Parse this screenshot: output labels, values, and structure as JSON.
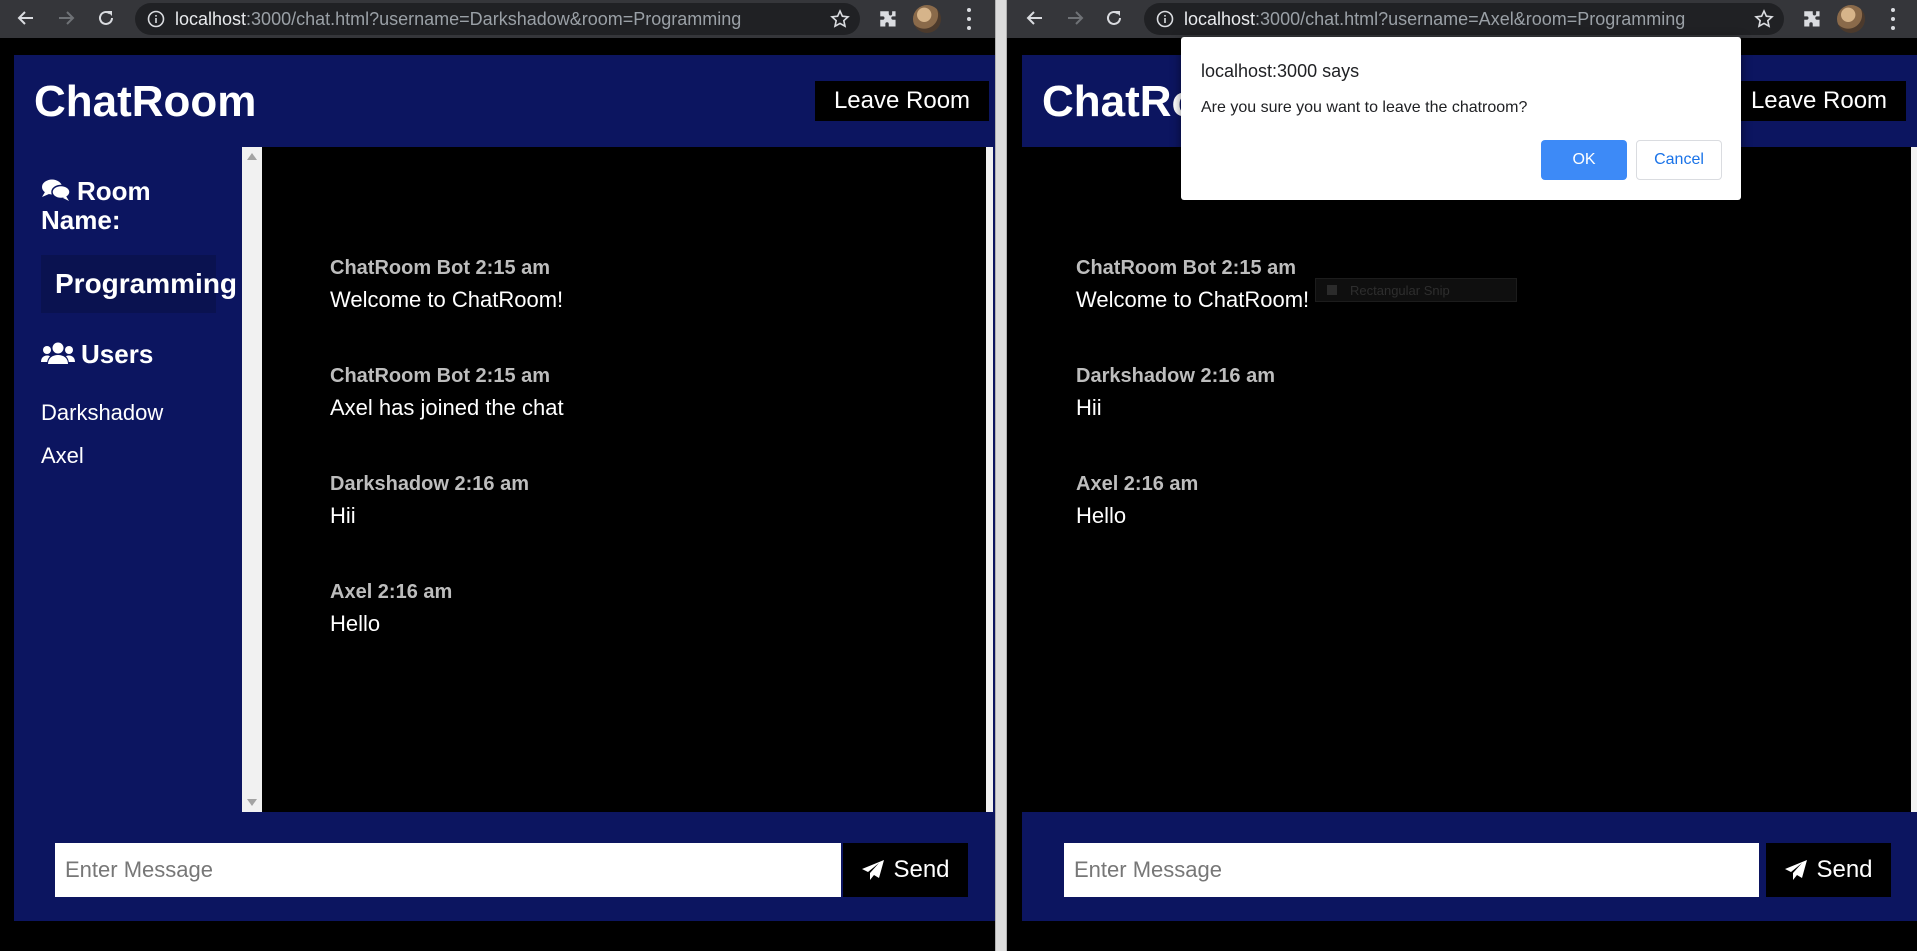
{
  "left": {
    "url": {
      "host": "localhost",
      "rest": ":3000/chat.html?username=Darkshadow&room=Programming"
    },
    "app_title": "ChatRoom",
    "leave_label": "Leave Room",
    "room_heading": "Room Name:",
    "room_heading_line1": "Room",
    "room_heading_line2": "Name:",
    "room_name": "Programming",
    "users_heading": "Users",
    "users": [
      "Darkshadow",
      "Axel"
    ],
    "messages": [
      {
        "meta": "ChatRoom Bot 2:15 am",
        "text": "Welcome to ChatRoom!"
      },
      {
        "meta": "ChatRoom Bot 2:15 am",
        "text": "Axel has joined the chat"
      },
      {
        "meta": "Darkshadow 2:16 am",
        "text": "Hii"
      },
      {
        "meta": "Axel 2:16 am",
        "text": "Hello"
      }
    ],
    "input_placeholder": "Enter Message",
    "send_label": "Send"
  },
  "right": {
    "url": {
      "host": "localhost",
      "rest": ":3000/chat.html?username=Axel&room=Programming"
    },
    "app_title": "ChatRo",
    "leave_label": "Leave Room",
    "messages": [
      {
        "meta": "ChatRoom Bot 2:15 am",
        "text": "Welcome to ChatRoom!"
      },
      {
        "meta": "Darkshadow 2:16 am",
        "text": "Hii"
      },
      {
        "meta": "Axel 2:16 am",
        "text": "Hello"
      }
    ],
    "input_placeholder": "Enter Message",
    "send_label": "Send"
  },
  "snip_label": "Rectangular Snip",
  "dialog": {
    "title": "localhost:3000 says",
    "message": "Are you sure you want to leave the chatroom?",
    "ok_label": "OK",
    "cancel_label": "Cancel"
  },
  "colors": {
    "app_bg": "#0c1560",
    "message_area": "#000000",
    "ok_button": "#3d8af7",
    "browser_toolbar": "#35363a"
  }
}
